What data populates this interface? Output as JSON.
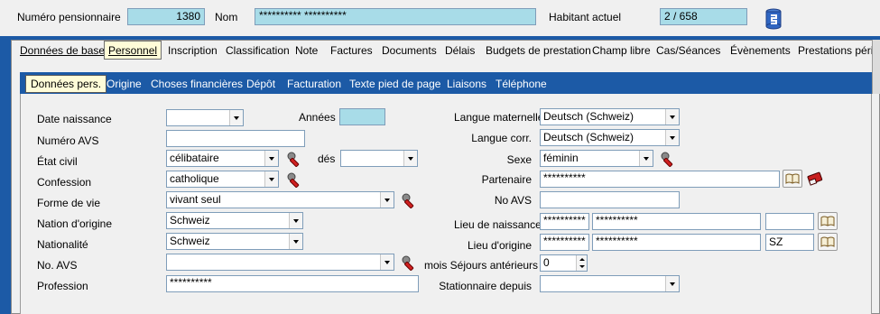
{
  "header": {
    "pension_number_label": "Numéro pensionnaire",
    "pension_number_value": "1380",
    "name_label": "Nom",
    "name_value": "********** **********",
    "current_resident_label": "Habitant actuel",
    "current_resident_value": "2 / 658"
  },
  "main_tabs": [
    {
      "label": "Données de base"
    },
    {
      "label": "Personnel"
    },
    {
      "label": "Inscription"
    },
    {
      "label": "Classification"
    },
    {
      "label": "Note"
    },
    {
      "label": "Factures"
    },
    {
      "label": "Documents"
    },
    {
      "label": "Délais"
    },
    {
      "label": "Budgets de prestation"
    },
    {
      "label": "Champ libre"
    },
    {
      "label": "Cas/Séances"
    },
    {
      "label": "Évènements"
    },
    {
      "label": "Prestations périodiq"
    }
  ],
  "sub_tabs": [
    {
      "label": "Données pers."
    },
    {
      "label": "Origine"
    },
    {
      "label": "Choses financières"
    },
    {
      "label": "Dépôt"
    },
    {
      "label": "Facturation"
    },
    {
      "label": "Texte pied de page"
    },
    {
      "label": "Liaisons"
    },
    {
      "label": "Téléphone"
    }
  ],
  "left": {
    "birth_date_label": "Date naissance",
    "birth_date_value": "",
    "years_label": "Années",
    "years_value": "",
    "avs_number_label": "Numéro AVS",
    "avs_number_value": "",
    "civil_status_label": "État civil",
    "civil_status_value": "célibataire",
    "since_label": "dés",
    "since_value": "",
    "confession_label": "Confession",
    "confession_value": "catholique",
    "life_form_label": "Forme de vie",
    "life_form_value": "vivant seul",
    "nation_origin_label": "Nation d'origine",
    "nation_origin_value": "Schweiz",
    "nationality_label": "Nationalité",
    "nationality_value": "Schweiz",
    "no_avs_label": "No. AVS",
    "no_avs_value": "",
    "profession_label": "Profession",
    "profession_value": "**********"
  },
  "right": {
    "mother_tongue_label": "Langue maternelle",
    "mother_tongue_value": "Deutsch (Schweiz)",
    "corr_language_label": "Langue corr.",
    "corr_language_value": "Deutsch (Schweiz)",
    "sex_label": "Sexe",
    "sex_value": "féminin",
    "partner_label": "Partenaire",
    "partner_value": "**********",
    "no_avs_label": "No AVS",
    "no_avs_value": "",
    "birthplace_label": "Lieu de naissance",
    "birthplace_value1": "**********",
    "birthplace_value2": "**********",
    "birthplace_value3": "",
    "origin_place_label": "Lieu d'origine",
    "origin_place_value1": "**********",
    "origin_place_value2": "**********",
    "origin_place_value3": "SZ",
    "previous_stays_label": "mois Séjours antérieurs",
    "previous_stays_value": "0",
    "stationary_since_label": "Stationnaire depuis",
    "stationary_since_value": ""
  }
}
